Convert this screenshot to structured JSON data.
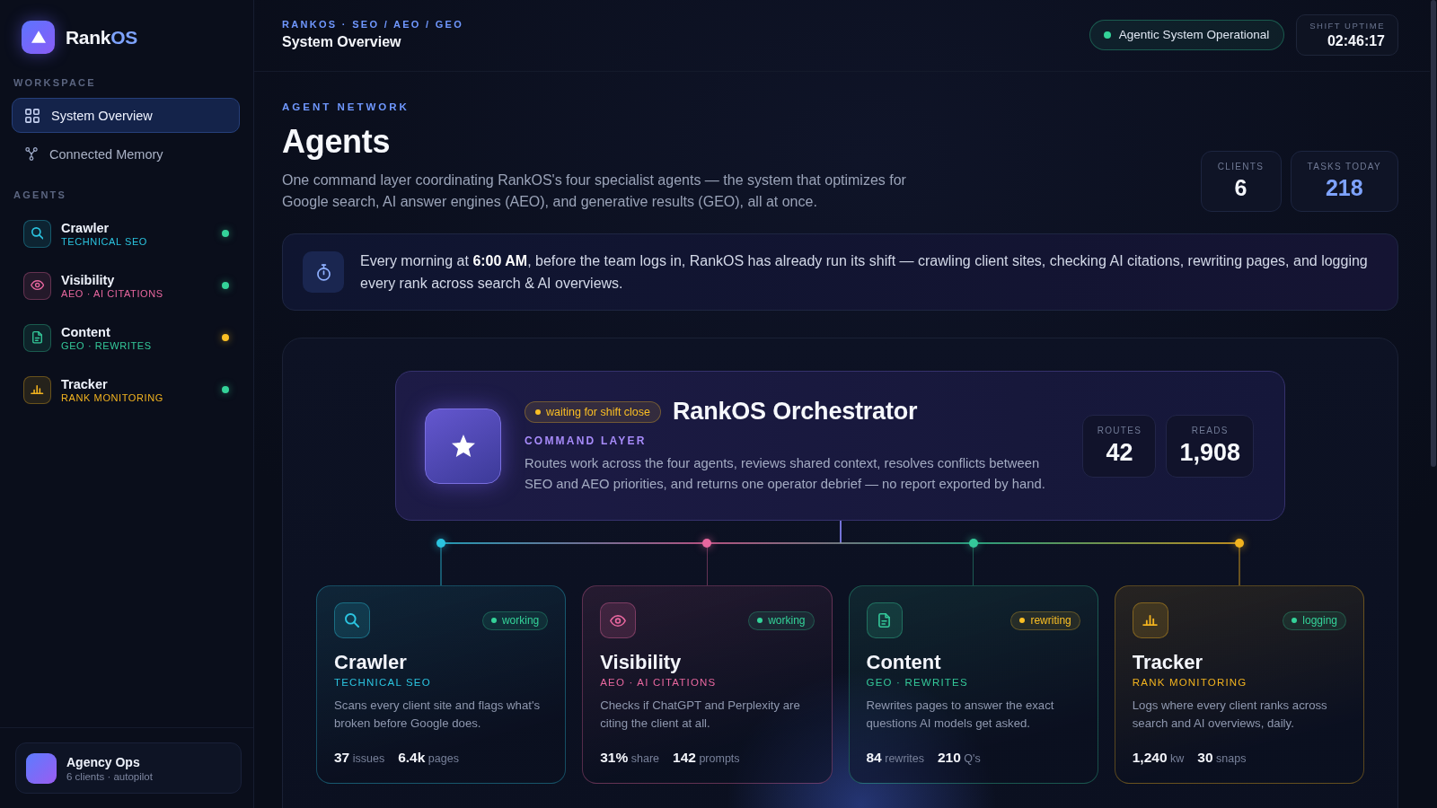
{
  "sidebar": {
    "brand": {
      "text": "Rank",
      "accent": "OS"
    },
    "workspace": {
      "heading": "WORKSPACE",
      "items": [
        {
          "label": "System Overview",
          "selected": true
        },
        {
          "label": "Connected Memory",
          "selected": false
        }
      ]
    },
    "agents": {
      "heading": "AGENTS",
      "items": [
        {
          "name": "Crawler",
          "subtitle": "TECHNICAL SEO",
          "color": "#2bc4e0",
          "status": {
            "color": "#34d399"
          }
        },
        {
          "name": "Visibility",
          "subtitle": "AEO · AI CITATIONS",
          "color": "#e8679f",
          "status": {
            "color": "#34d399"
          }
        },
        {
          "name": "Content",
          "subtitle": "GEO · REWRITES",
          "color": "#34c99a",
          "status": {
            "color": "#fbbf24"
          }
        },
        {
          "name": "Tracker",
          "subtitle": "RANK MONITORING",
          "color": "#f2b31f",
          "status": {
            "color": "#34d399"
          }
        }
      ]
    },
    "account": {
      "name": "Agency Ops",
      "detail": "6 clients · autopilot"
    }
  },
  "header": {
    "breadcrumb": "RANKOS · SEO / AEO / GEO",
    "title": "System Overview",
    "status": {
      "label": "Agentic System Operational",
      "color": "#34d399"
    },
    "uptime": {
      "label": "SHIFT UPTIME",
      "value": "02:46:17"
    }
  },
  "intro": {
    "eyebrow": "AGENT NETWORK",
    "title": "Agents",
    "description": "One command layer coordinating RankOS's four specialist agents — the system that optimizes for Google search, AI answer engines (AEO), and generative results (GEO), all at once.",
    "stats": [
      {
        "label": "CLIENTS",
        "value": "6",
        "highlight": false
      },
      {
        "label": "TASKS TODAY",
        "value": "218",
        "highlight": true
      }
    ]
  },
  "callout": {
    "text": "Every morning at **6:00 AM**, before the team logs in, RankOS has already run its shift — crawling client sites, checking AI citations, rewriting pages, and logging every rank across search & AI overviews."
  },
  "network": {
    "orchestrator": {
      "status": {
        "label": "waiting for shift close",
        "color": "#fbbf24"
      },
      "name": "RankOS Orchestrator",
      "subtitle": "COMMAND LAYER",
      "description": "Routes work across the four agents, reviews shared context, resolves conflicts between SEO and AEO priorities, and returns one operator debrief — no report exported by hand.",
      "stats": [
        {
          "label": "ROUTES",
          "value": "42"
        },
        {
          "label": "READS",
          "value": "1,908"
        }
      ]
    },
    "agents": [
      {
        "name": "Crawler",
        "subtitle": "TECHNICAL SEO",
        "color": "#2bc4e0",
        "status": {
          "label": "working",
          "color": "#34d399"
        },
        "description": "Scans every client site and flags what's broken before Google does.",
        "metrics": [
          {
            "value": "37",
            "unit": "issues"
          },
          {
            "value": "6.4k",
            "unit": "pages"
          }
        ]
      },
      {
        "name": "Visibility",
        "subtitle": "AEO · AI CITATIONS",
        "color": "#e8679f",
        "status": {
          "label": "working",
          "color": "#34d399"
        },
        "description": "Checks if ChatGPT and Perplexity are citing the client at all.",
        "metrics": [
          {
            "value": "31%",
            "unit": "share"
          },
          {
            "value": "142",
            "unit": "prompts"
          }
        ]
      },
      {
        "name": "Content",
        "subtitle": "GEO · REWRITES",
        "color": "#34c99a",
        "status": {
          "label": "rewriting",
          "color": "#fbbf24"
        },
        "description": "Rewrites pages to answer the exact questions AI models get asked.",
        "metrics": [
          {
            "value": "84",
            "unit": "rewrites"
          },
          {
            "value": "210",
            "unit": "Q's"
          }
        ]
      },
      {
        "name": "Tracker",
        "subtitle": "RANK MONITORING",
        "color": "#f2b31f",
        "status": {
          "label": "logging",
          "color": "#34d399"
        },
        "description": "Logs where every client ranks across search and AI overviews, daily.",
        "metrics": [
          {
            "value": "1,240",
            "unit": "kw"
          },
          {
            "value": "30",
            "unit": "snaps"
          }
        ]
      }
    ]
  }
}
